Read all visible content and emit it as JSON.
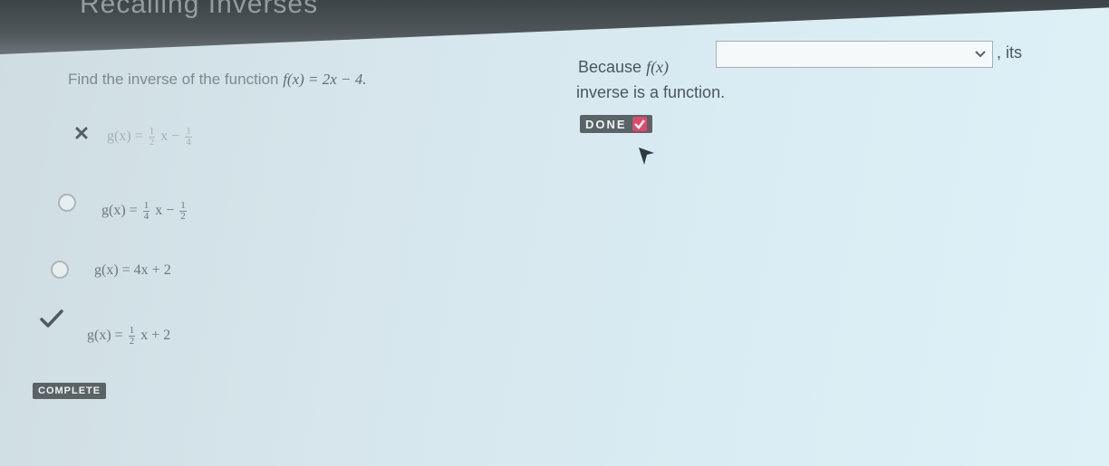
{
  "header": {
    "title": "Recalling Inverses"
  },
  "question": {
    "prefix": "Find the inverse of the function ",
    "function": "f(x) = 2x − 4."
  },
  "options": [
    {
      "lhs": "g(x) = ",
      "f1": [
        "1",
        "2"
      ],
      "mid": " x − ",
      "f2": [
        "1",
        "4"
      ],
      "status": "incorrect"
    },
    {
      "lhs": "g(x) = ",
      "f1": [
        "1",
        "4"
      ],
      "mid": " x − ",
      "f2": [
        "1",
        "2"
      ],
      "status": "unselected"
    },
    {
      "text": "g(x) = 4x + 2",
      "status": "unselected"
    },
    {
      "lhs": "g(x) = ",
      "f1": [
        "1",
        "2"
      ],
      "mid": " x + 2",
      "status": "correct"
    }
  ],
  "complete_label": "COMPLETE",
  "right": {
    "because": "Because ",
    "fx": "f(x)",
    "dropdown_value": "",
    "its": ", its",
    "line2": "inverse is a function.",
    "done_label": "DONE"
  },
  "colors": {
    "badge": "#5a6366",
    "done_check": "#e0486a"
  }
}
